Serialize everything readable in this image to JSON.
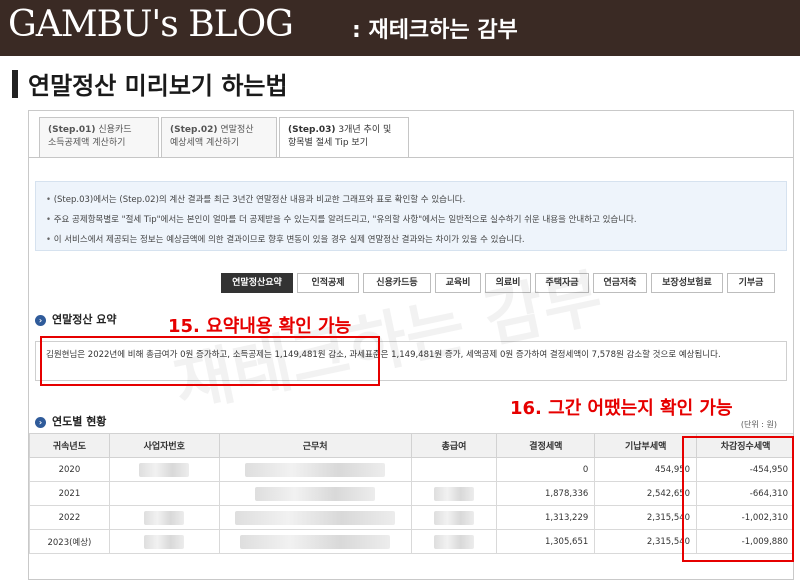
{
  "banner": {
    "title": "GAMBU's BLOG",
    "subtitle": ": 재테크하는 감부"
  },
  "heading": "연말정산 미리보기 하는법",
  "tabs": [
    {
      "step": "(Step.01)",
      "line1": "신용카드",
      "line2": "소득공제액 계산하기",
      "active": false
    },
    {
      "step": "(Step.02)",
      "line1": "연말정산",
      "line2": "예상세액 계산하기",
      "active": false
    },
    {
      "step": "(Step.03)",
      "line1": "3개년 추이 및",
      "line2": "항목별 절세 Tip 보기",
      "active": true
    }
  ],
  "info": [
    "(Step.03)에서는 (Step.02)의 계산 결과를 최근 3년간 연말정산 내용과 비교한 그래프와 표로 확인할 수 있습니다.",
    "주요 공제항목별로 \"절세 Tip\"에서는 본인이 얼마를 더 공제받을 수 있는지를 알려드리고, \"유의할 사항\"에서는 일반적으로 실수하기 쉬운 내용을 안내하고 있습니다.",
    "이 서비스에서 제공되는 정보는 예상금액에 의한 결과이므로 향후 변동이 있을 경우 실제 연말정산 결과와는 차이가 있을 수 있습니다."
  ],
  "menu": [
    "연말정산요약",
    "인적공제",
    "신용카드등",
    "교육비",
    "의료비",
    "주택자금",
    "연금저축",
    "보장성보험료",
    "기부금"
  ],
  "summary": {
    "title": "연말정산 요약",
    "text": "김원현님은 2022년에 비해 총급여가 0원 증가하고, 소득공제는 1,149,481원 감소, 과세표준은 1,149,481원 증가, 세액공제 0원 증가하여 결정세액이 7,578원 감소할 것으로 예상됩니다."
  },
  "history": {
    "title": "연도별 현황",
    "unit": "(단위 : 원)",
    "columns": [
      "귀속년도",
      "사업자번호",
      "근무처",
      "총급여",
      "결정세액",
      "기납부세액",
      "차감징수세액"
    ],
    "rows": [
      {
        "year": "2020",
        "decided": "0",
        "prepaid": "454,950",
        "diff": "-454,950"
      },
      {
        "year": "2021",
        "decided": "1,878,336",
        "prepaid": "2,542,650",
        "diff": "-664,310"
      },
      {
        "year": "2022",
        "decided": "1,313,229",
        "prepaid": "2,315,540",
        "diff": "-1,002,310"
      },
      {
        "year": "2023(예상)",
        "decided": "1,305,651",
        "prepaid": "2,315,540",
        "diff": "-1,009,880"
      }
    ]
  },
  "annotations": {
    "a15": "15. 요약내용 확인 가능",
    "a16": "16. 그간 어땠는지 확인 가능",
    "color": "#e60000"
  },
  "watermark": "재테크하는 감부"
}
